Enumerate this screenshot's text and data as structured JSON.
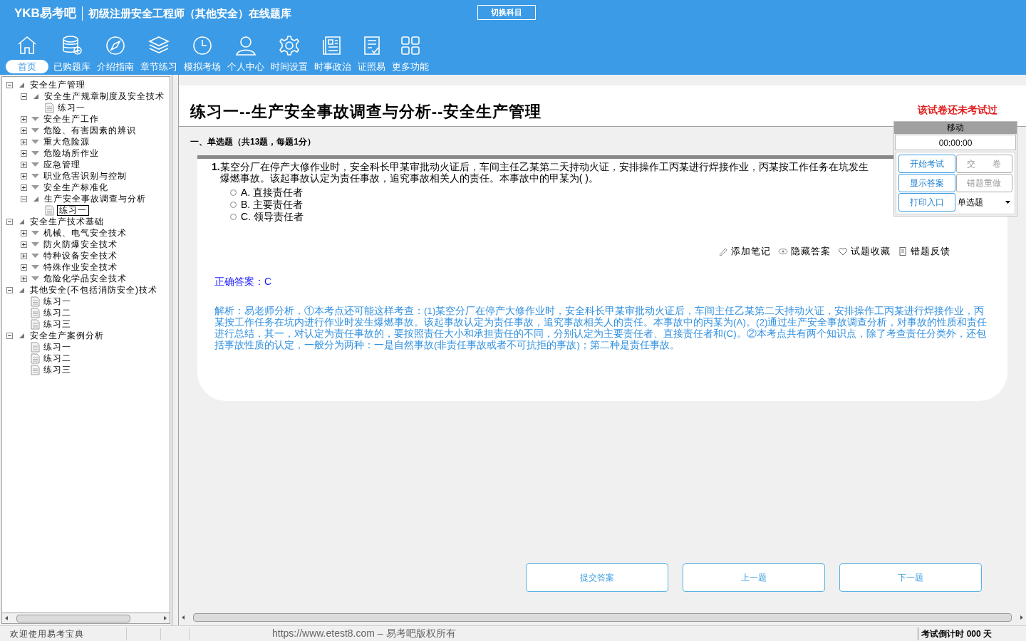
{
  "header": {
    "logo": "YKB易考吧",
    "title": "初级注册安全工程师（其他安全）在线题库",
    "switch_button": "切换科目"
  },
  "nav": [
    {
      "label": "首页",
      "selected": true
    },
    {
      "label": "已购题库",
      "selected": false
    },
    {
      "label": "介绍指南",
      "selected": false
    },
    {
      "label": "章节练习",
      "selected": false
    },
    {
      "label": "模拟考场",
      "selected": false
    },
    {
      "label": "个人中心",
      "selected": false
    },
    {
      "label": "时间设置",
      "selected": false
    },
    {
      "label": "时事政治",
      "selected": false
    },
    {
      "label": "证照易",
      "selected": false
    },
    {
      "label": "更多功能",
      "selected": false
    }
  ],
  "tree": [
    {
      "kind": "folder",
      "label": "安全生产管理",
      "expanded": true,
      "children": [
        {
          "kind": "folder",
          "label": "安全生产规章制度及安全技术",
          "expanded": true,
          "children": [
            {
              "kind": "leaf",
              "label": "练习一",
              "selected": false
            }
          ]
        },
        {
          "kind": "folder",
          "label": "安全生产工作",
          "expanded": false
        },
        {
          "kind": "folder",
          "label": "危险、有害因素的辨识",
          "expanded": false
        },
        {
          "kind": "folder",
          "label": "重大危险源",
          "expanded": false
        },
        {
          "kind": "folder",
          "label": "危险场所作业",
          "expanded": false
        },
        {
          "kind": "folder",
          "label": "应急管理",
          "expanded": false
        },
        {
          "kind": "folder",
          "label": "职业危害识别与控制",
          "expanded": false
        },
        {
          "kind": "folder",
          "label": "安全生产标准化",
          "expanded": false
        },
        {
          "kind": "folder",
          "label": "生产安全事故调查与分析",
          "expanded": true,
          "children": [
            {
              "kind": "leaf",
              "label": "练习一",
              "selected": true
            }
          ]
        }
      ]
    },
    {
      "kind": "folder",
      "label": "安全生产技术基础",
      "expanded": true,
      "children": [
        {
          "kind": "folder",
          "label": "机械、电气安全技术",
          "expanded": false
        },
        {
          "kind": "folder",
          "label": "防火防爆安全技术",
          "expanded": false
        },
        {
          "kind": "folder",
          "label": "特种设备安全技术",
          "expanded": false
        },
        {
          "kind": "folder",
          "label": "特殊作业安全技术",
          "expanded": false
        },
        {
          "kind": "folder",
          "label": "危险化学品安全技术",
          "expanded": false
        }
      ]
    },
    {
      "kind": "folder",
      "label": "其他安全(不包括消防安全)技术",
      "expanded": true,
      "children": [
        {
          "kind": "leaf",
          "label": "练习一",
          "selected": false
        },
        {
          "kind": "leaf",
          "label": "练习二",
          "selected": false
        },
        {
          "kind": "leaf",
          "label": "练习三",
          "selected": false
        }
      ]
    },
    {
      "kind": "folder",
      "label": "安全生产案例分析",
      "expanded": true,
      "children": [
        {
          "kind": "leaf",
          "label": "练习一",
          "selected": false
        },
        {
          "kind": "leaf",
          "label": "练习二",
          "selected": false
        },
        {
          "kind": "leaf",
          "label": "练习三",
          "selected": false
        }
      ]
    }
  ],
  "exam": {
    "title": "练习一--生产安全事故调查与分析--安全生产管理",
    "status": "该试卷还未考试过",
    "section": "一、单选题（共13题，每题1分）",
    "question_number": "1.",
    "question": "某空分厂在停产大修作业时，安全科长甲某审批动火证后，车间主任乙某第二天持动火证，安排操作工丙某进行焊接作业，丙某按工作任务在坑发生爆燃事故。该起事故认定为责任事故，追究事故相关人的责任。本事故中的甲某为( )。",
    "options": [
      {
        "label": "A. 直接责任者",
        "selected": false
      },
      {
        "label": "B. 主要责任者",
        "selected": false
      },
      {
        "label": "C. 领导责任者",
        "selected": false
      }
    ],
    "tools": [
      "添加笔记",
      "隐藏答案",
      "试题收藏",
      "错题反馈"
    ],
    "answer": "正确答案：C",
    "explanation": "解析：易老师分析，①本考点还可能这样考查：(1)某空分厂在停产大修作业时，安全科长甲某审批动火证后，车间主任乙某第二天持动火证，安排操作工丙某进行焊接作业，丙某按工作任务在坑内进行作业时发生爆燃事故。该起事故认定为责任事故，追究事故相关人的责任。本事故中的丙某为(A)。(2)通过生产安全事故调查分析，对事故的性质和责任进行总结，其一，对认定为责任事故的，要按照责任大小和承担责任的不同，分别认定为主要责任者、直接责任者和(C)。②本考点共有两个知识点，除了考查责任分类外，还包括事故性质的认定，一般分为两种：一是自然事故(非责任事故或者不可抗拒的事故)；第二种是责任事故。",
    "buttons": [
      "提交答案",
      "上一题",
      "下一题"
    ]
  },
  "panel": {
    "title": "移动",
    "timer": "00:00:00",
    "buttons": [
      {
        "label": "开始考试",
        "disabled": false
      },
      {
        "label": "交　　卷",
        "disabled": true
      },
      {
        "label": "显示答案",
        "disabled": false
      },
      {
        "label": "错题重做",
        "disabled": true
      },
      {
        "label": "打印入口",
        "disabled": false
      }
    ],
    "question_type": "单选题"
  },
  "status_bar": {
    "welcome": "欢迎使用易考宝典",
    "copyright": "https://www.etest8.com – 易考吧版权所有",
    "countdown": "考试倒计时 000 天"
  }
}
